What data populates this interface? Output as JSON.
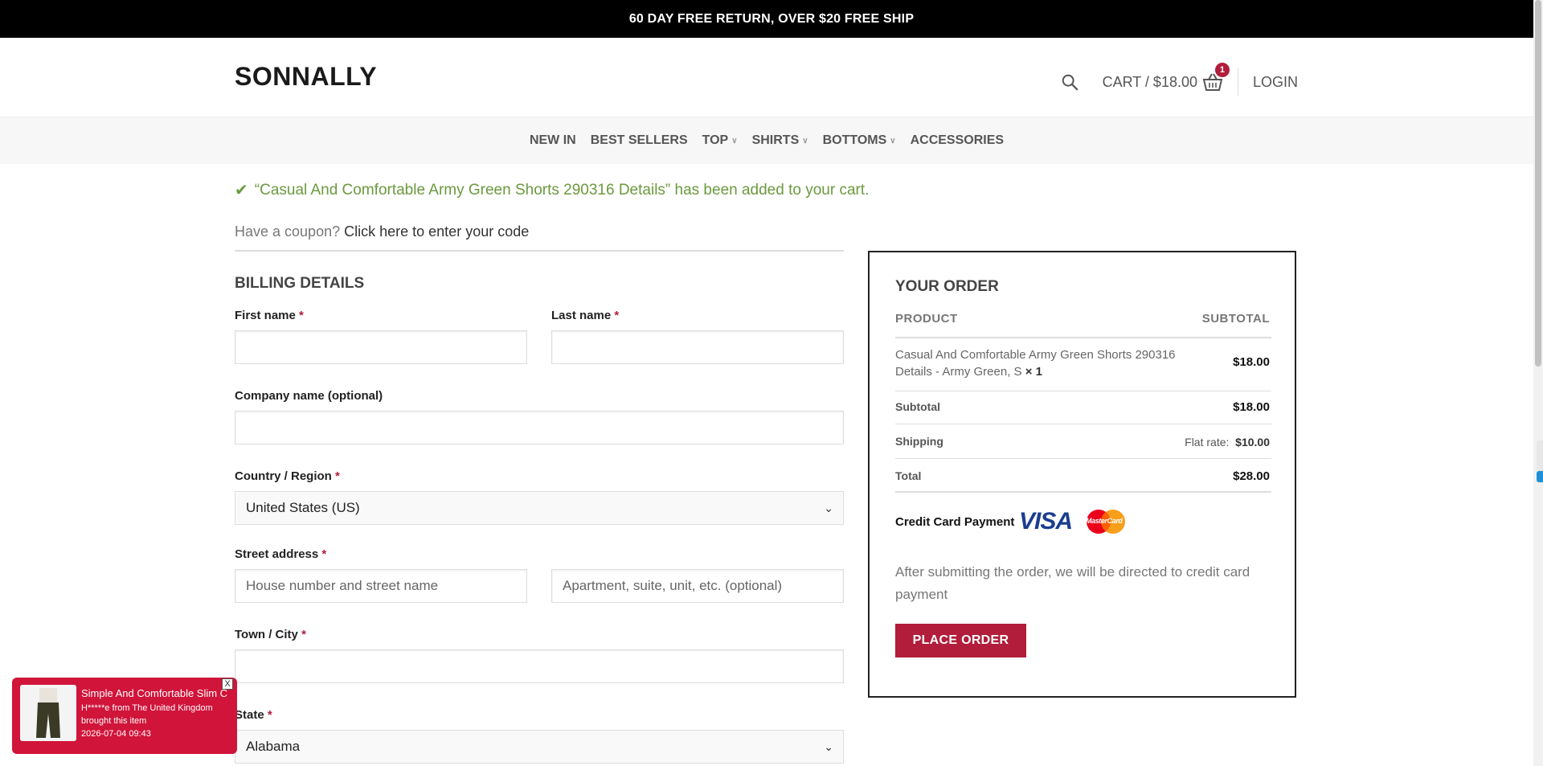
{
  "topbar": {
    "text": "60 DAY FREE RETURN, OVER $20 FREE SHIP"
  },
  "header": {
    "logo": "SONNALLY",
    "cart_label": "CART / $18.00",
    "cart_count": "1",
    "login": "LOGIN"
  },
  "nav": {
    "items": [
      {
        "label": "NEW IN",
        "has_dropdown": false
      },
      {
        "label": "BEST SELLERS",
        "has_dropdown": false
      },
      {
        "label": "TOP",
        "has_dropdown": true
      },
      {
        "label": "SHIRTS",
        "has_dropdown": true
      },
      {
        "label": "BOTTOMS",
        "has_dropdown": true
      },
      {
        "label": "ACCESSORIES",
        "has_dropdown": false
      }
    ]
  },
  "notice": {
    "text": "“Casual And Comfortable Army Green Shorts 290316 Details” has been added to your cart."
  },
  "coupon": {
    "prefix": "Have a coupon?",
    "link": "Click here to enter your code"
  },
  "billing": {
    "title": "BILLING DETAILS",
    "first_name_label": "First name",
    "last_name_label": "Last name",
    "company_label": "Company name (optional)",
    "country_label": "Country / Region",
    "country_value": "United States (US)",
    "street_label": "Street address",
    "street_placeholder_1": "House number and street name",
    "street_placeholder_2": "Apartment, suite, unit, etc. (optional)",
    "city_label": "Town / City",
    "state_label": "State",
    "state_value": "Alabama",
    "required_mark": "*"
  },
  "order": {
    "title": "YOUR ORDER",
    "col_product": "PRODUCT",
    "col_subtotal": "SUBTOTAL",
    "product_name": "Casual And Comfortable Army Green Shorts 290316 Details - Army Green, S",
    "product_qty": "× 1",
    "product_price": "$18.00",
    "subtotal_label": "Subtotal",
    "subtotal_value": "$18.00",
    "shipping_label": "Shipping",
    "shipping_method": "Flat rate:",
    "shipping_value": "$10.00",
    "total_label": "Total",
    "total_value": "$28.00",
    "payment_label": "Credit Card Payment",
    "visa_text": "VISA",
    "mastercard_text": "MasterCard",
    "payment_desc": "After submitting the order, we will be directed to credit card payment",
    "place_order": "PLACE ORDER"
  },
  "popup": {
    "title": "Simple And Comfortable Slim C",
    "line1": "H*****e from The United Kingdom",
    "line2": "brought this item",
    "time": "2026-07-04 09:43",
    "close": "X"
  }
}
